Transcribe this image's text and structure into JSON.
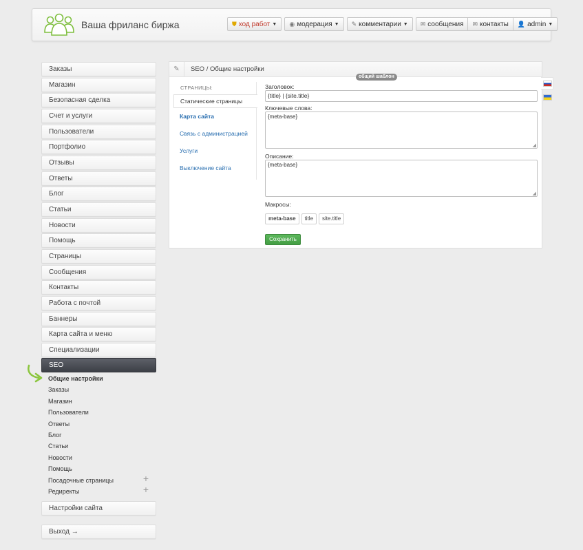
{
  "header": {
    "site_title": "Ваша фриланс биржа",
    "nav": [
      {
        "label": "ход работ",
        "icon": "shield-icon",
        "dropdown": true
      },
      {
        "label": "модерация",
        "icon": "eye-icon",
        "dropdown": true
      },
      {
        "label": "комментарии",
        "icon": "pencil-icon",
        "dropdown": true
      }
    ],
    "group": [
      {
        "label": "сообщения",
        "icon": "envelope-icon"
      },
      {
        "label": "контакты",
        "icon": "envelope-icon"
      },
      {
        "label": "admin",
        "icon": "user-icon",
        "dropdown": true
      }
    ]
  },
  "sidebar": {
    "items": [
      {
        "label": "Заказы"
      },
      {
        "label": "Магазин"
      },
      {
        "label": "Безопасная сделка"
      },
      {
        "label": "Счет и услуги"
      },
      {
        "label": "Пользователи"
      },
      {
        "label": "Портфолио"
      },
      {
        "label": "Отзывы"
      },
      {
        "label": "Ответы"
      },
      {
        "label": "Блог"
      },
      {
        "label": "Статьи"
      },
      {
        "label": "Новости"
      },
      {
        "label": "Помощь"
      },
      {
        "label": "Страницы"
      },
      {
        "label": "Сообщения"
      },
      {
        "label": "Контакты"
      },
      {
        "label": "Работа с почтой"
      },
      {
        "label": "Баннеры"
      },
      {
        "label": "Карта сайта и меню"
      },
      {
        "label": "Специализации"
      },
      {
        "label": "SEO",
        "active": true
      }
    ],
    "sub_items": [
      {
        "label": "Общие настройки",
        "active": true
      },
      {
        "label": "Заказы"
      },
      {
        "label": "Магазин"
      },
      {
        "label": "Пользователи"
      },
      {
        "label": "Ответы"
      },
      {
        "label": "Блог"
      },
      {
        "label": "Статьи"
      },
      {
        "label": "Новости"
      },
      {
        "label": "Помощь"
      },
      {
        "label": "Посадочные страницы",
        "expandable": true
      },
      {
        "label": "Редиректы",
        "expandable": true
      }
    ],
    "settings_label": "Настройки сайта",
    "logout_label": "Выход →"
  },
  "panel": {
    "breadcrumb": "SEO / Общие настройки",
    "badge": "общий шаблон",
    "pages_label": "СТРАНИЦЫ:",
    "pages": [
      {
        "label": "Статические страницы",
        "active": true
      },
      {
        "label": "Карта сайта",
        "bold": true
      },
      {
        "label": "Связь с администрацией"
      },
      {
        "label": "Услуги"
      },
      {
        "label": "Выключение сайта"
      }
    ],
    "form": {
      "title_label": "Заголовок:",
      "title_value": "{title} | {site.title}",
      "keywords_label": "Ключевые слова:",
      "keywords_value": "{meta-base}",
      "description_label": "Описание:",
      "description_value": "{meta-base}",
      "macros_label": "Макросы:",
      "macros": [
        "meta-base",
        "title",
        "site.title"
      ],
      "save_label": "Сохранить"
    }
  },
  "colors": {
    "accent": "#2a6fb0",
    "active_nav": "#464950",
    "save": "#5cb85c",
    "arrow": "#8cc63f"
  }
}
